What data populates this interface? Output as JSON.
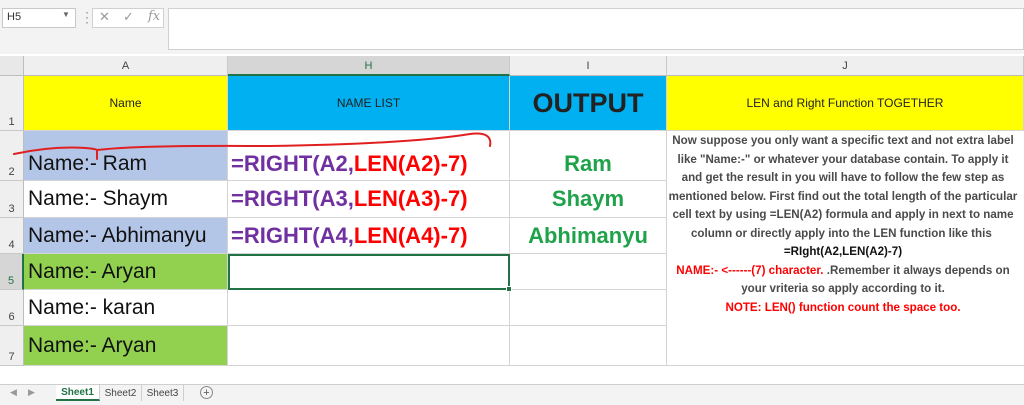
{
  "formula_bar": {
    "name_box": "H5",
    "cancel_symbol": "✕",
    "enter_symbol": "✓",
    "fx_label": "fx",
    "formula": ""
  },
  "columns": [
    "A",
    "H",
    "I",
    "J"
  ],
  "rows": [
    "1",
    "2",
    "3",
    "4",
    "5",
    "6",
    "7"
  ],
  "header_row": {
    "name": "Name",
    "name_list": "NAME LIST",
    "output": "OUTPUT",
    "len_right": "LEN and Right Function TOGETHER"
  },
  "data_rows": [
    {
      "name": "Name:- Ram",
      "formula_a": "=RIGHT(A2,",
      "formula_b": "LEN(A2)-7)",
      "output": "Ram"
    },
    {
      "name": "Name:- Shaym",
      "formula_a": "=RIGHT(A3,",
      "formula_b": "LEN(A3)-7)",
      "output": "Shaym"
    },
    {
      "name": "Name:- Abhimanyu",
      "formula_a": "=RIGHT(A4,",
      "formula_b": "LEN(A4)-7)",
      "output": "Abhimanyu"
    },
    {
      "name": "Name:- Aryan",
      "formula_a": "",
      "formula_b": "",
      "output": ""
    },
    {
      "name": "Name:- karan",
      "formula_a": "",
      "formula_b": "",
      "output": ""
    },
    {
      "name": "Name:- Aryan",
      "formula_a": "",
      "formula_b": "",
      "output": ""
    }
  ],
  "description": {
    "body": "Now suppose you only want a specific text and not extra label like \"Name:-\" or whatever your database contain. To apply it and get the result in you will have to follow the few step as mentioned below. First find out the total length of the particular cell text by using =LEN(A2) formula and apply in next to name column or directly apply into the LEN function like this",
    "formula": "=RIght(A2,LEN(A2)-7)",
    "name_note": "NAME:- <------(7) character.",
    "remember": ".Remember it always depends on your vriteria so apply according to it.",
    "note": "NOTE: LEN() function count the space too."
  },
  "sheets": [
    "Sheet1",
    "Sheet2",
    "Sheet3"
  ],
  "add_sheet_symbol": "+",
  "colors": {
    "accent": "#217346",
    "yellow": "#ffff00",
    "cyan": "#00b0f0",
    "light_blue": "#b4c6e7",
    "green_fill": "#92d050",
    "formula_purple": "#7030a0",
    "formula_red": "#ff0000",
    "output_green": "#1fa24a"
  }
}
